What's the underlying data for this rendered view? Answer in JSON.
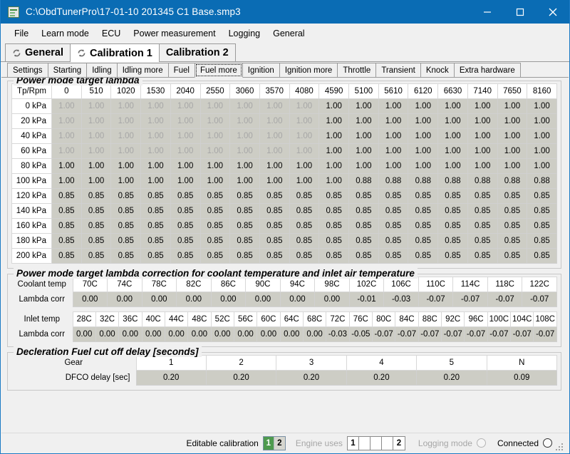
{
  "window": {
    "title": "C:\\ObdTunerPro\\17-01-10 201345 C1 Base.smp3",
    "icon": "document-icon",
    "minimize": "minimize-icon",
    "maximize": "maximize-icon",
    "close": "close-icon",
    "titlebar_color": "#0a6cb4"
  },
  "menubar": {
    "items": [
      "File",
      "Learn mode",
      "ECU",
      "Power measurement",
      "Logging",
      "General"
    ]
  },
  "top_tabs": [
    {
      "label": "General",
      "icon": "sync-icon",
      "active": false
    },
    {
      "label": "Calibration 1",
      "icon": "sync-icon",
      "active": true
    },
    {
      "label": "Calibration 2",
      "icon": null,
      "active": false
    }
  ],
  "sub_tabs": [
    {
      "label": "Settings",
      "active": false
    },
    {
      "label": "Starting",
      "active": false
    },
    {
      "label": "Idling",
      "active": false
    },
    {
      "label": "Idling more",
      "active": false
    },
    {
      "label": "Fuel",
      "active": false
    },
    {
      "label": "Fuel more",
      "active": true
    },
    {
      "label": "Ignition",
      "active": false
    },
    {
      "label": "Ignition more",
      "active": false
    },
    {
      "label": "Throttle",
      "active": false
    },
    {
      "label": "Transient",
      "active": false
    },
    {
      "label": "Knock",
      "active": false
    },
    {
      "label": "Extra hardware",
      "active": false
    }
  ],
  "groups": {
    "power_lambda": {
      "title": "Power mode target lambda",
      "corner_header": "Tp/Rpm",
      "columns": [
        "0",
        "510",
        "1020",
        "1530",
        "2040",
        "2550",
        "3060",
        "3570",
        "4080",
        "4590",
        "5100",
        "5610",
        "6120",
        "6630",
        "7140",
        "7650",
        "8160"
      ],
      "rows": [
        {
          "label": "0 kPa",
          "values": [
            "1.00",
            "1.00",
            "1.00",
            "1.00",
            "1.00",
            "1.00",
            "1.00",
            "1.00",
            "1.00",
            "1.00",
            "1.00",
            "1.00",
            "1.00",
            "1.00",
            "1.00",
            "1.00",
            "1.00"
          ],
          "styles": [
            "dis",
            "dis",
            "dis",
            "dis",
            "dis",
            "dis",
            "dis",
            "dis",
            "dis",
            "yellow",
            "yellow",
            "yellow",
            "yellow",
            "yellow",
            "yellow",
            "yellow",
            "yellow"
          ]
        },
        {
          "label": "20 kPa",
          "values": [
            "1.00",
            "1.00",
            "1.00",
            "1.00",
            "1.00",
            "1.00",
            "1.00",
            "1.00",
            "1.00",
            "1.00",
            "1.00",
            "1.00",
            "1.00",
            "1.00",
            "1.00",
            "1.00",
            "1.00"
          ],
          "styles": [
            "dis",
            "dis",
            "dis",
            "dis",
            "dis",
            "dis",
            "dis",
            "dis",
            "dis",
            "yellow",
            "yellow",
            "yellow",
            "yellow",
            "yellow",
            "yellow",
            "yellow",
            "yellow"
          ]
        },
        {
          "label": "40 kPa",
          "values": [
            "1.00",
            "1.00",
            "1.00",
            "1.00",
            "1.00",
            "1.00",
            "1.00",
            "1.00",
            "1.00",
            "1.00",
            "1.00",
            "1.00",
            "1.00",
            "1.00",
            "1.00",
            "1.00",
            "1.00"
          ],
          "styles": [
            "dis",
            "dis",
            "dis",
            "dis",
            "dis",
            "dis",
            "dis",
            "dis",
            "dis",
            "yellow",
            "yellow",
            "yellow",
            "yellow",
            "yellow",
            "yellow",
            "yellow",
            "yellow"
          ]
        },
        {
          "label": "60 kPa",
          "values": [
            "1.00",
            "1.00",
            "1.00",
            "1.00",
            "1.00",
            "1.00",
            "1.00",
            "1.00",
            "1.00",
            "1.00",
            "1.00",
            "1.00",
            "1.00",
            "1.00",
            "1.00",
            "1.00",
            "1.00"
          ],
          "styles": [
            "dis",
            "dis",
            "dis",
            "dis",
            "dis",
            "dis",
            "dis",
            "dis",
            "dis",
            "yellow",
            "yellow",
            "yellow",
            "yellow",
            "yellow",
            "yellow",
            "yellow",
            "yellow"
          ]
        },
        {
          "label": "80 kPa",
          "values": [
            "1.00",
            "1.00",
            "1.00",
            "1.00",
            "1.00",
            "1.00",
            "1.00",
            "1.00",
            "1.00",
            "1.00",
            "1.00",
            "1.00",
            "1.00",
            "1.00",
            "1.00",
            "1.00",
            "1.00"
          ],
          "styles": [
            "yellow",
            "yellow",
            "yellow",
            "yellow",
            "yellow",
            "yellow",
            "yellow",
            "yellow",
            "yellow",
            "yellow",
            "yellow",
            "yellow",
            "yellow",
            "yellow",
            "yellow",
            "yellow",
            "yellow"
          ]
        },
        {
          "label": "100 kPa",
          "values": [
            "1.00",
            "1.00",
            "1.00",
            "1.00",
            "1.00",
            "1.00",
            "1.00",
            "1.00",
            "1.00",
            "1.00",
            "0.88",
            "0.88",
            "0.88",
            "0.88",
            "0.88",
            "0.88",
            "0.88"
          ],
          "styles": [
            "yellow",
            "yellow",
            "yellow",
            "yellow",
            "yellow",
            "yellow",
            "yellow",
            "yellow",
            "yellow",
            "yellow",
            "khaki",
            "khaki",
            "khaki",
            "khaki",
            "khaki",
            "khaki",
            "khaki"
          ]
        },
        {
          "label": "120 kPa",
          "values": [
            "0.85",
            "0.85",
            "0.85",
            "0.85",
            "0.85",
            "0.85",
            "0.85",
            "0.85",
            "0.85",
            "0.85",
            "0.85",
            "0.85",
            "0.85",
            "0.85",
            "0.85",
            "0.85",
            "0.85"
          ],
          "styles": [
            "gray",
            "gray",
            "gray",
            "gray",
            "gray",
            "gray",
            "gray",
            "gray",
            "gray",
            "gray",
            "gray",
            "gray",
            "gray",
            "gray",
            "gray",
            "gray",
            "gray"
          ]
        },
        {
          "label": "140 kPa",
          "values": [
            "0.85",
            "0.85",
            "0.85",
            "0.85",
            "0.85",
            "0.85",
            "0.85",
            "0.85",
            "0.85",
            "0.85",
            "0.85",
            "0.85",
            "0.85",
            "0.85",
            "0.85",
            "0.85",
            "0.85"
          ],
          "styles": [
            "gray",
            "gray",
            "gray",
            "gray",
            "gray",
            "gray",
            "gray",
            "gray",
            "gray",
            "gray",
            "gray",
            "gray",
            "gray",
            "gray",
            "gray",
            "gray",
            "gray"
          ]
        },
        {
          "label": "160 kPa",
          "values": [
            "0.85",
            "0.85",
            "0.85",
            "0.85",
            "0.85",
            "0.85",
            "0.85",
            "0.85",
            "0.85",
            "0.85",
            "0.85",
            "0.85",
            "0.85",
            "0.85",
            "0.85",
            "0.85",
            "0.85"
          ],
          "styles": [
            "gray",
            "gray",
            "gray",
            "gray",
            "gray",
            "gray",
            "gray",
            "gray",
            "gray",
            "gray",
            "gray",
            "gray",
            "gray",
            "gray",
            "gray",
            "gray",
            "gray"
          ]
        },
        {
          "label": "180 kPa",
          "values": [
            "0.85",
            "0.85",
            "0.85",
            "0.85",
            "0.85",
            "0.85",
            "0.85",
            "0.85",
            "0.85",
            "0.85",
            "0.85",
            "0.85",
            "0.85",
            "0.85",
            "0.85",
            "0.85",
            "0.85"
          ],
          "styles": [
            "gray",
            "gray",
            "gray",
            "gray",
            "gray",
            "gray",
            "gray",
            "gray",
            "gray",
            "gray",
            "gray",
            "gray",
            "gray",
            "gray",
            "gray",
            "gray",
            "gray"
          ]
        },
        {
          "label": "200 kPa",
          "values": [
            "0.85",
            "0.85",
            "0.85",
            "0.85",
            "0.85",
            "0.85",
            "0.85",
            "0.85",
            "0.85",
            "0.85",
            "0.85",
            "0.85",
            "0.85",
            "0.85",
            "0.85",
            "0.85",
            "0.85"
          ],
          "styles": [
            "gray",
            "gray",
            "gray",
            "gray",
            "gray",
            "gray",
            "gray",
            "gray",
            "gray",
            "gray",
            "gray",
            "gray",
            "gray",
            "gray",
            "gray",
            "gray",
            "gray"
          ]
        }
      ]
    },
    "temp_correction": {
      "title": "Power mode target lambda correction for coolant temperature and inlet air temperature",
      "coolant": {
        "header_label": "Coolant temp",
        "value_label": "Lambda corr",
        "columns": [
          "70C",
          "74C",
          "78C",
          "82C",
          "86C",
          "90C",
          "94C",
          "98C",
          "102C",
          "106C",
          "110C",
          "114C",
          "118C",
          "122C"
        ],
        "values": [
          "0.00",
          "0.00",
          "0.00",
          "0.00",
          "0.00",
          "0.00",
          "0.00",
          "0.00",
          "-0.01",
          "-0.03",
          "-0.07",
          "-0.07",
          "-0.07",
          "-0.07"
        ],
        "styles": [
          "yellow",
          "yellow",
          "yellow",
          "yellow",
          "yellow",
          "yellow",
          "yellow",
          "yellow",
          "khaki",
          "khaki2",
          "gray",
          "gray",
          "gray",
          "gray"
        ]
      },
      "inlet": {
        "header_label": "Inlet temp",
        "value_label": "Lambda corr",
        "columns": [
          "28C",
          "32C",
          "36C",
          "40C",
          "44C",
          "48C",
          "52C",
          "56C",
          "60C",
          "64C",
          "68C",
          "72C",
          "76C",
          "80C",
          "84C",
          "88C",
          "92C",
          "96C",
          "100C",
          "104C",
          "108C"
        ],
        "values": [
          "0.00",
          "0.00",
          "0.00",
          "0.00",
          "0.00",
          "0.00",
          "0.00",
          "0.00",
          "0.00",
          "0.00",
          "0.00",
          "-0.03",
          "-0.05",
          "-0.07",
          "-0.07",
          "-0.07",
          "-0.07",
          "-0.07",
          "-0.07",
          "-0.07",
          "-0.07"
        ],
        "styles": [
          "yellow",
          "yellow",
          "yellow",
          "yellow",
          "yellow",
          "yellow",
          "yellow",
          "yellow",
          "yellow",
          "yellow",
          "yellow",
          "khaki",
          "khaki2",
          "gray",
          "gray",
          "gray",
          "gray",
          "gray",
          "gray",
          "gray",
          "gray"
        ]
      }
    },
    "dfco": {
      "title": "Decleration Fuel cut off delay [seconds]",
      "header_label": "Gear",
      "value_label": "DFCO delay [sec]",
      "columns": [
        "1",
        "2",
        "3",
        "4",
        "5",
        "N"
      ],
      "values": [
        "0.20",
        "0.20",
        "0.20",
        "0.20",
        "0.20",
        "0.09"
      ],
      "styles": [
        "yellow",
        "yellow",
        "yellow",
        "yellow",
        "yellow",
        "gray"
      ]
    }
  },
  "statusbar": {
    "editable_calibration_label": "Editable calibration",
    "calibration_boxes": [
      {
        "label": "1",
        "selected": true
      },
      {
        "label": "2",
        "selected": false
      }
    ],
    "engine_uses_label": "Engine uses",
    "engine_uses_boxes": [
      "1",
      "",
      "",
      "",
      "2"
    ],
    "logging_mode_label": "Logging mode",
    "logging_mode_on": false,
    "connected_label": "Connected",
    "connected_on": false,
    "resize_grip": "resize-grip-icon"
  }
}
